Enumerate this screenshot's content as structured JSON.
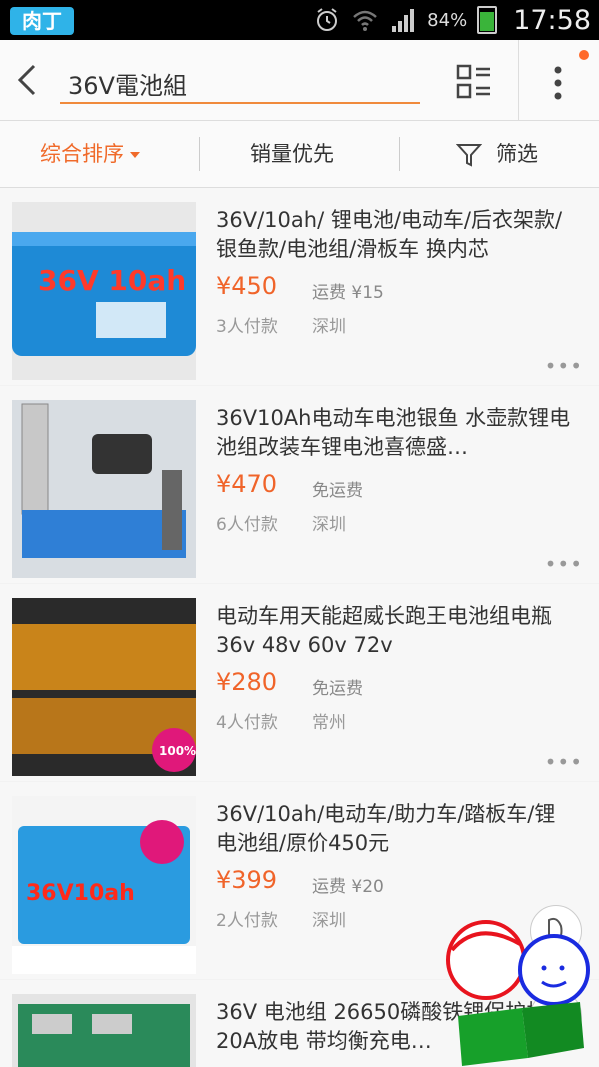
{
  "status": {
    "battery": "84%",
    "time": "17:58",
    "logo": "肉丁"
  },
  "search": {
    "query": "36V電池組"
  },
  "sort": {
    "comprehensive": "综合排序",
    "sales_first": "销量优先",
    "filter": "筛选"
  },
  "items": [
    {
      "title": "36V/10ah/ 锂电池/电动车/后衣架款/银鱼款/电池组/滑板车 换内芯",
      "price": "¥450",
      "shipping": "运费 ¥15",
      "sales": "3人付款",
      "city": "深圳",
      "thumb_text": "36V 10ah",
      "thumb_color": "#1e8ad6"
    },
    {
      "title": "36V10Ah电动车电池银鱼 水壶款锂电池组改装车锂电池喜德盛…",
      "price": "¥470",
      "shipping": "免运费",
      "sales": "6人付款",
      "city": "深圳",
      "thumb_color": "#2f7fd6"
    },
    {
      "title": "电动车用天能超威长跑王电池组电瓶 36v 48v 60v 72v",
      "price": "¥280",
      "shipping": "免运费",
      "sales": "4人付款",
      "city": "常州",
      "thumb_badge": "100%",
      "thumb_color": "#c9841a"
    },
    {
      "title": "36V/10ah/电动车/助力车/踏板车/锂电池组/原价450元",
      "price": "¥399",
      "shipping": "运费 ¥20",
      "sales": "2人付款",
      "city": "深圳",
      "thumb_text": "36V10ah",
      "thumb_color": "#2a9be0"
    },
    {
      "title": "36V 电池组 26650磷酸铁锂保护板 20A放电 带均衡充电…",
      "thumb_color": "#2a8a5a"
    }
  ],
  "colors": {
    "accent": "#f06a2a",
    "price": "#f0642a"
  }
}
